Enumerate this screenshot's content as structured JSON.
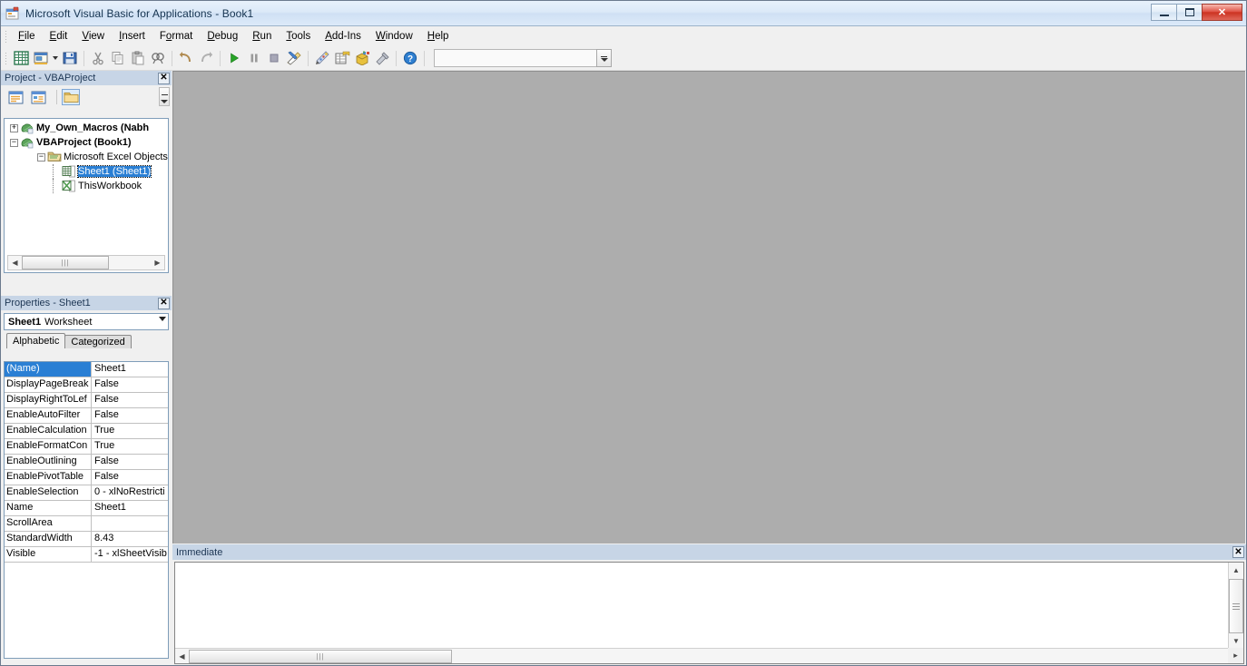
{
  "window": {
    "title": "Microsoft Visual Basic for Applications - Book1",
    "icon": "vba-app-icon",
    "minimize_label": "Minimize",
    "maximize_label": "Restore",
    "close_label": "✕"
  },
  "menubar": {
    "items": [
      {
        "label": "File",
        "accel": "F"
      },
      {
        "label": "Edit",
        "accel": "E"
      },
      {
        "label": "View",
        "accel": "V"
      },
      {
        "label": "Insert",
        "accel": "I"
      },
      {
        "label": "Format",
        "accel": "o"
      },
      {
        "label": "Debug",
        "accel": "D"
      },
      {
        "label": "Run",
        "accel": "R"
      },
      {
        "label": "Tools",
        "accel": "T"
      },
      {
        "label": "Add-Ins",
        "accel": "A"
      },
      {
        "label": "Window",
        "accel": "W"
      },
      {
        "label": "Help",
        "accel": "H"
      }
    ]
  },
  "toolbar": {
    "buttons": [
      {
        "name": "view-excel-icon",
        "title": "View Microsoft Excel"
      },
      {
        "name": "insert-userform-icon",
        "title": "Insert UserForm"
      },
      {
        "name": "insert-dropdown-icon",
        "title": "Insert dropdown"
      },
      {
        "name": "save-icon",
        "title": "Save Book1"
      },
      {
        "name": "cut-icon",
        "title": "Cut"
      },
      {
        "name": "copy-icon",
        "title": "Copy"
      },
      {
        "name": "paste-icon",
        "title": "Paste"
      },
      {
        "name": "find-icon",
        "title": "Find"
      },
      {
        "name": "undo-icon",
        "title": "Undo"
      },
      {
        "name": "redo-icon",
        "title": "Redo"
      },
      {
        "name": "run-icon",
        "title": "Run Sub/UserForm"
      },
      {
        "name": "pause-icon",
        "title": "Break"
      },
      {
        "name": "stop-icon",
        "title": "Reset"
      },
      {
        "name": "design-mode-icon",
        "title": "Design Mode"
      },
      {
        "name": "project-explorer-icon",
        "title": "Project Explorer"
      },
      {
        "name": "properties-window-icon",
        "title": "Properties Window"
      },
      {
        "name": "object-browser-icon",
        "title": "Object Browser"
      },
      {
        "name": "toolbox-icon",
        "title": "Toolbox"
      },
      {
        "name": "help-icon",
        "title": "Microsoft Visual Basic for Applications Help"
      }
    ],
    "combo_value": ""
  },
  "project_explorer": {
    "title": "Project - VBAProject",
    "close_label": "✕",
    "toolbar": [
      {
        "name": "view-code-icon",
        "title": "View Code"
      },
      {
        "name": "view-object-icon",
        "title": "View Object"
      },
      {
        "name": "toggle-folders-icon",
        "title": "Toggle Folders"
      }
    ],
    "tree": [
      {
        "label": "My_Own_Macros (Nabh",
        "expander": "+",
        "icon": "vba-project-icon",
        "indent": 0,
        "bold": true,
        "selected": false
      },
      {
        "label": "VBAProject (Book1)",
        "expander": "-",
        "icon": "vba-project-icon",
        "indent": 0,
        "bold": true,
        "selected": false
      },
      {
        "label": "Microsoft Excel Objects",
        "expander": "-",
        "icon": "folder-icon",
        "indent": 1,
        "bold": false,
        "selected": false
      },
      {
        "label": "Sheet1 (Sheet1)",
        "expander": "",
        "icon": "worksheet-icon",
        "indent": 2,
        "bold": false,
        "selected": true
      },
      {
        "label": "ThisWorkbook",
        "expander": "",
        "icon": "workbook-icon",
        "indent": 2,
        "bold": false,
        "selected": false
      }
    ]
  },
  "properties": {
    "title": "Properties - Sheet1",
    "close_label": "✕",
    "object_name": "Sheet1",
    "object_type": "Worksheet",
    "tabs": [
      {
        "label": "Alphabetic",
        "active": true
      },
      {
        "label": "Categorized",
        "active": false
      }
    ],
    "rows": [
      {
        "name": "(Name)",
        "value": "Sheet1",
        "selected": true
      },
      {
        "name": "DisplayPageBreak",
        "value": "False",
        "selected": false
      },
      {
        "name": "DisplayRightToLef",
        "value": "False",
        "selected": false
      },
      {
        "name": "EnableAutoFilter",
        "value": "False",
        "selected": false
      },
      {
        "name": "EnableCalculation",
        "value": "True",
        "selected": false
      },
      {
        "name": "EnableFormatCon",
        "value": "True",
        "selected": false
      },
      {
        "name": "EnableOutlining",
        "value": "False",
        "selected": false
      },
      {
        "name": "EnablePivotTable",
        "value": "False",
        "selected": false
      },
      {
        "name": "EnableSelection",
        "value": "0 - xlNoRestricti",
        "selected": false
      },
      {
        "name": "Name",
        "value": "Sheet1",
        "selected": false
      },
      {
        "name": "ScrollArea",
        "value": "",
        "selected": false
      },
      {
        "name": "StandardWidth",
        "value": "8.43",
        "selected": false
      },
      {
        "name": "Visible",
        "value": "-1 - xlSheetVisib",
        "selected": false
      }
    ]
  },
  "immediate": {
    "title": "Immediate",
    "close_label": "✕",
    "content": ""
  },
  "colors": {
    "titlebar_accent": "#cfe0f4",
    "panel_title_bg": "#c7d5e6",
    "selection_blue": "#2a7fd4",
    "mdi_gray": "#adadad",
    "chrome": "#f0f0f0",
    "close_red": "#cc3322"
  }
}
